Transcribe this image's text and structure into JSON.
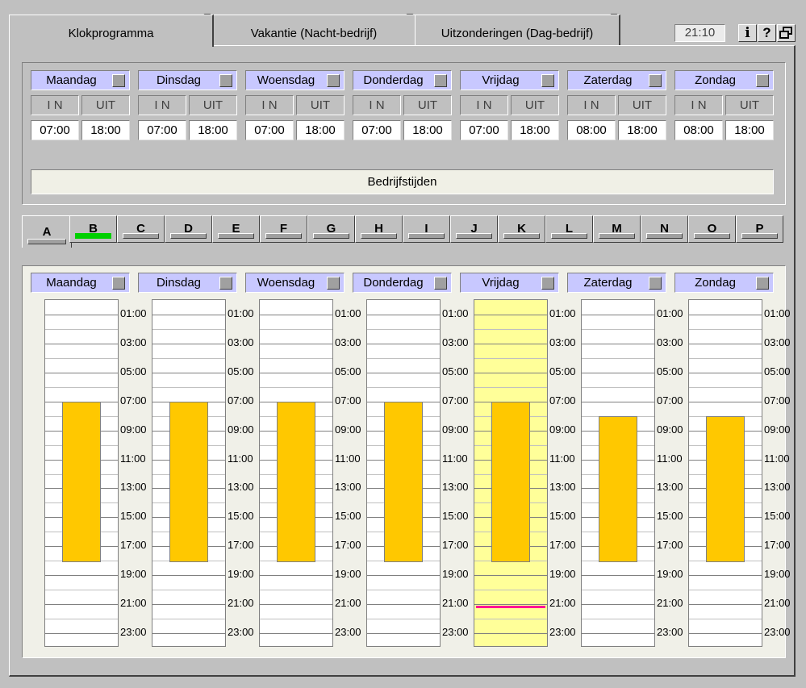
{
  "tabs": [
    {
      "label": "Klokprogramma",
      "active": true
    },
    {
      "label": "Vakantie  (Nacht-bedrijf)",
      "active": false
    },
    {
      "label": "Uitzonderingen (Dag-bedrijf)",
      "active": false
    }
  ],
  "clock": "21:10",
  "header_buttons": {
    "info": "i",
    "help": "?",
    "window": "window-restore-icon"
  },
  "days": [
    "Maandag",
    "Dinsdag",
    "Woensdag",
    "Donderdag",
    "Vrijdag",
    "Zaterdag",
    "Zondag"
  ],
  "col_labels": {
    "in": "I N",
    "out": "UIT"
  },
  "schedule": [
    {
      "in": "07:00",
      "out": "18:00"
    },
    {
      "in": "07:00",
      "out": "18:00"
    },
    {
      "in": "07:00",
      "out": "18:00"
    },
    {
      "in": "07:00",
      "out": "18:00"
    },
    {
      "in": "07:00",
      "out": "18:00"
    },
    {
      "in": "08:00",
      "out": "18:00"
    },
    {
      "in": "08:00",
      "out": "18:00"
    }
  ],
  "bedrijfstijden_label": "Bedrijfstijden",
  "program_tabs": [
    "A",
    "B",
    "C",
    "D",
    "E",
    "F",
    "G",
    "H",
    "I",
    "J",
    "K",
    "L",
    "M",
    "N",
    "O",
    "P"
  ],
  "active_program": "A",
  "program_indicator_on": "B",
  "time_ticks": [
    "01:00",
    "03:00",
    "05:00",
    "07:00",
    "09:00",
    "11:00",
    "13:00",
    "15:00",
    "17:00",
    "19:00",
    "21:00",
    "23:00"
  ],
  "today_index": 4,
  "current_time_hours": 21.17,
  "colors": {
    "day_header": "#c8c8ff",
    "busy": "#ffc800",
    "today": "#ffff99",
    "now_line": "#ff1493",
    "indicator": "#00d000"
  }
}
